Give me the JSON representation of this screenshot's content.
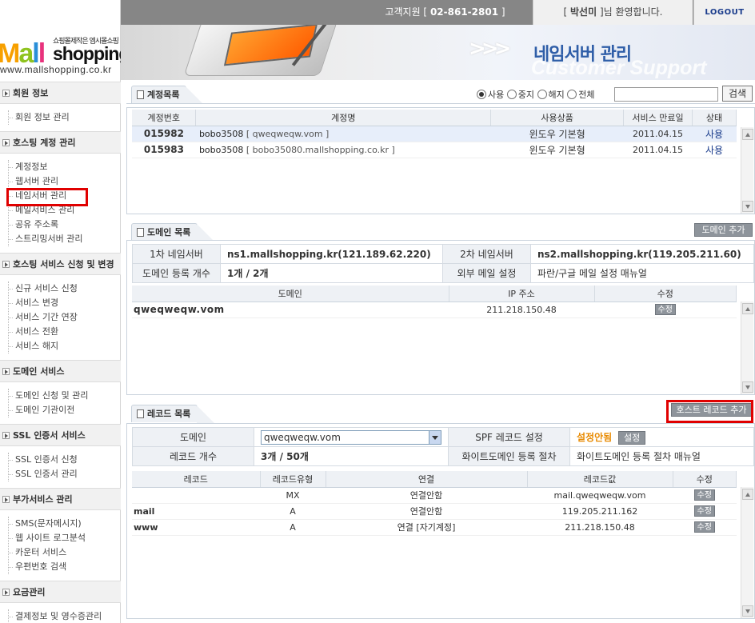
{
  "topbar": {
    "support_prefix": "고객지원 [ ",
    "support_phone": "02-861-2801",
    "support_suffix": " ]",
    "welcome_prefix": "[ ",
    "user_name": "박선미",
    "welcome_suffix": " ]님 환영합니다.",
    "logout": "LOGOUT"
  },
  "logo": {
    "tagline": "쇼핑몰제작은 엠시몰쇼핑",
    "mall_m": "M",
    "mall_a": "a",
    "mall_l1": "l",
    "mall_l2": "l",
    "shop": "shopping",
    "url": "www.mallshopping.co.kr"
  },
  "banner": {
    "title": "네임서버 관리",
    "subtitle": "Customer Support"
  },
  "sidebar": {
    "sections": [
      {
        "title": "회원 정보",
        "items": [
          "회원 정보 관리"
        ]
      },
      {
        "title": "호스팅 계정 관리",
        "items": [
          "계정정보",
          "웹서버 관리",
          "네임서버 관리",
          "메일서비스 관리",
          "공유 주소록",
          "스트리밍서버 관리"
        ]
      },
      {
        "title": "호스팅 서비스 신청 및 변경",
        "items": [
          "신규 서비스 신청",
          "서비스 변경",
          "서비스 기간 연장",
          "서비스 전환",
          "서비스 해지"
        ]
      },
      {
        "title": "도메인 서비스",
        "items": [
          "도메인 신청 및 관리",
          "도메인 기관이전"
        ]
      },
      {
        "title": "SSL 인증서 서비스",
        "items": [
          "SSL 인증서 신청",
          "SSL 인증서 관리"
        ]
      },
      {
        "title": "부가서비스 관리",
        "items": [
          "SMS(문자메시지)",
          "웹 사이트 로그분석",
          "카운터 서비스",
          "우편번호 검색"
        ]
      },
      {
        "title": "요금관리",
        "items": [
          "결제정보 및 영수증관리"
        ]
      }
    ]
  },
  "accounts": {
    "tab": "계정목록",
    "filters": [
      "사용",
      "중지",
      "해지",
      "전체"
    ],
    "selected_filter": "사용",
    "search_value": "",
    "search_button": "검색",
    "columns": [
      "계정번호",
      "계정명",
      "사용상품",
      "서비스 만료일",
      "상태"
    ],
    "rows": [
      {
        "id": "015982",
        "name_user": "bobo3508",
        "name_domain": "[ qweqweqw.vom ]",
        "product": "윈도우 기본형",
        "expire": "2011.04.15",
        "status": "사용"
      },
      {
        "id": "015983",
        "name_user": "bobo3508",
        "name_domain": "[ bobo35080.mallshopping.co.kr ]",
        "product": "윈도우 기본형",
        "expire": "2011.04.15",
        "status": "사용"
      }
    ]
  },
  "domains": {
    "tab": "도메인 목록",
    "add_button": "도메인 추가",
    "ns1_label": "1차 네임서버",
    "ns1_value": "ns1.mallshopping.kr(121.189.62.220)",
    "ns2_label": "2차 네임서버",
    "ns2_value": "ns2.mallshopping.kr(119.205.211.60)",
    "count_label": "도메인 등록 개수",
    "count_value": "1개 / 2개",
    "mail_label": "외부 메일 설정",
    "mail_value": "파란/구글 메일 설정 매뉴얼",
    "columns": [
      "도메인",
      "IP 주소",
      "수정"
    ],
    "rows": [
      {
        "domain": "qweqweqw.vom",
        "ip": "211.218.150.48",
        "edit": "수정"
      }
    ]
  },
  "records": {
    "tab": "레코드 목록",
    "add_button": "호스트 레코드 추가",
    "domain_label": "도메인",
    "domain_value": "qweqweqw.vom",
    "spf_label": "SPF 레코드 설정",
    "spf_status": "설정안됨",
    "spf_button": "설정",
    "count_label": "레코드 개수",
    "count_value": "3개 / 50개",
    "white_label": "화이트도메인 등록 절차",
    "white_value": "화이트도메인 등록 절차 매뉴얼",
    "columns": [
      "레코드",
      "레코드유형",
      "연결",
      "레코드값",
      "수정"
    ],
    "rows": [
      {
        "record": "",
        "type": "MX",
        "link": "연결안함",
        "value": "mail.qweqweqw.vom",
        "edit": "수정"
      },
      {
        "record": "mail",
        "type": "A",
        "link": "연결안함",
        "value": "119.205.211.162",
        "edit": "수정"
      },
      {
        "record": "www",
        "type": "A",
        "link": "연결 [자기계정]",
        "value": "211.218.150.48",
        "edit": "수정"
      }
    ]
  },
  "colors": {
    "accent_blue": "#2f5ea8",
    "status_blue": "#1a3c8c",
    "highlight_red": "#e00000",
    "warn_orange": "#e88a00"
  }
}
